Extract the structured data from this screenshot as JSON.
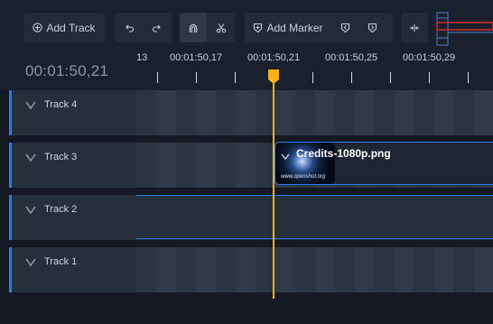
{
  "toolbar": {
    "add_track_label": "Add Track",
    "add_marker_label": "Add Marker",
    "icons": [
      "add-track-icon",
      "undo-icon",
      "redo-icon",
      "snap-magnet-icon",
      "razor-scissors-icon",
      "marker-icon",
      "previous-marker-icon",
      "next-marker-icon",
      "center-timeline-icon"
    ]
  },
  "time_display": "00:01:50,21",
  "ruler": {
    "labels": [
      "13",
      "00:01:50,17",
      "00:01:50,21",
      "00:01:50,25",
      "00:01:50,29"
    ]
  },
  "tracks": [
    {
      "name": "Track 4"
    },
    {
      "name": "Track 3"
    },
    {
      "name": "Track 2"
    },
    {
      "name": "Track 1"
    }
  ],
  "clip": {
    "title": "Credits-1080p.png",
    "thumb_url_text": "www.openshot.org"
  },
  "colors": {
    "accent_blue": "#2a7cf0",
    "playhead": "#f6b11a",
    "background": "#141923"
  }
}
